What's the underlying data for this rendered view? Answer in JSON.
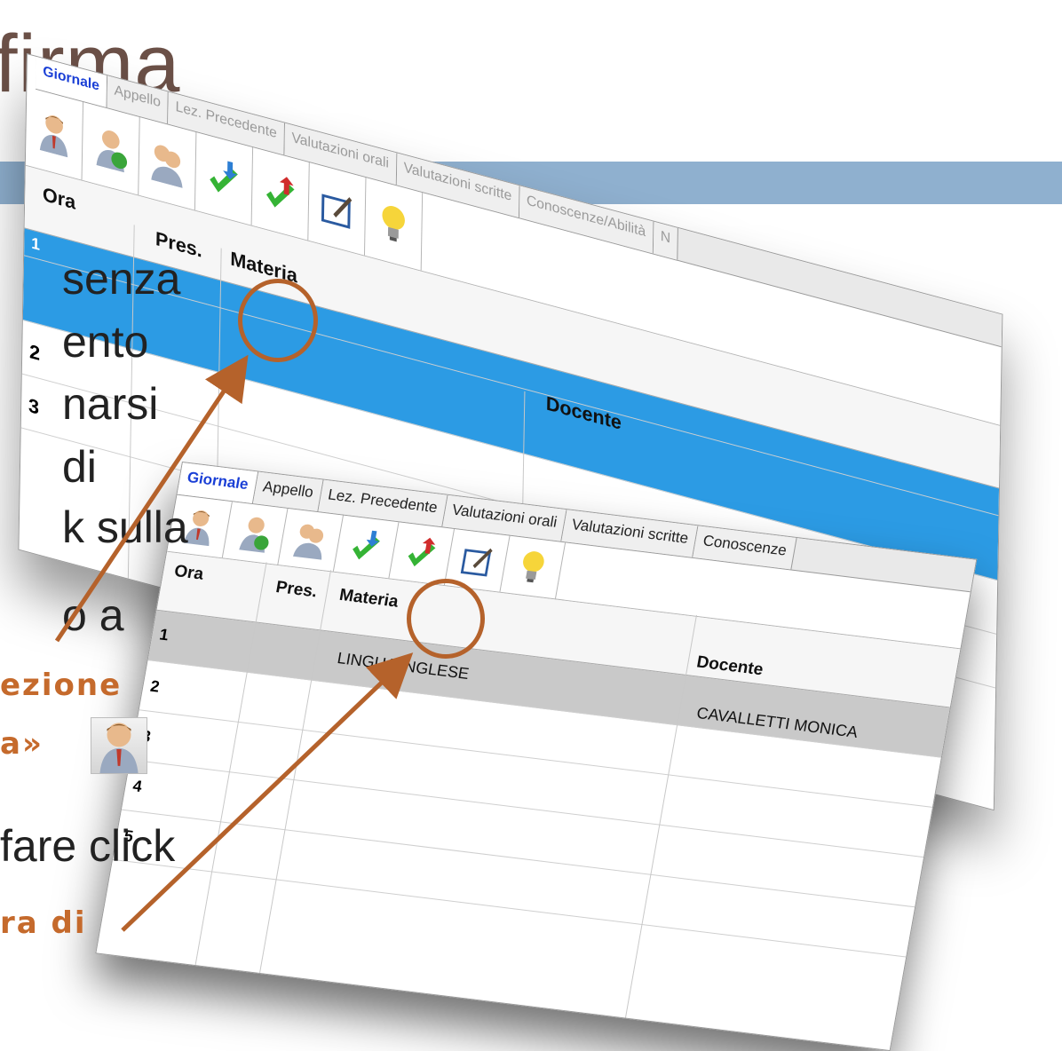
{
  "slide": {
    "title": "firma",
    "left_lines": [
      "senza",
      "ento",
      "narsi",
      "di",
      "k sulla",
      "o a",
      "fare click"
    ],
    "left_bold": [
      "ezione",
      "a»",
      "ra di"
    ]
  },
  "screens": {
    "tabs": [
      "Giornale",
      "Appello",
      "Lez. Precedente",
      "Valutazioni orali",
      "Valutazioni scritte",
      "Conoscenze"
    ],
    "back_tabs": [
      "Giornale",
      "Appello",
      "Lez. Precedente",
      "Valutazioni orali",
      "Valutazioni scritte",
      "Conoscenze/Abilità",
      "N"
    ],
    "toolbar_icons": [
      "teacher-icon",
      "teacher-swap-icon",
      "teachers-icon",
      "check-down-icon",
      "check-up-icon",
      "edit-note-icon",
      "lightbulb-icon"
    ],
    "columns": {
      "ora": "Ora",
      "pres": "Pres.",
      "materia": "Materia",
      "docente": "Docente"
    },
    "rows": [
      {
        "ora": "1",
        "materia": "LINGUA INGLESE",
        "docente": "CAVALLETTI MONICA"
      },
      {
        "ora": "2",
        "materia": "",
        "docente": ""
      },
      {
        "ora": "3",
        "materia": "",
        "docente": ""
      },
      {
        "ora": "4",
        "materia": "",
        "docente": ""
      },
      {
        "ora": "5",
        "materia": "",
        "docente": ""
      }
    ],
    "back_rows": [
      "1",
      "2",
      "3"
    ]
  },
  "colors": {
    "accent": "#c56a2c",
    "selected_row": "#2c9be4",
    "title_bar": "#8fb0cf"
  }
}
